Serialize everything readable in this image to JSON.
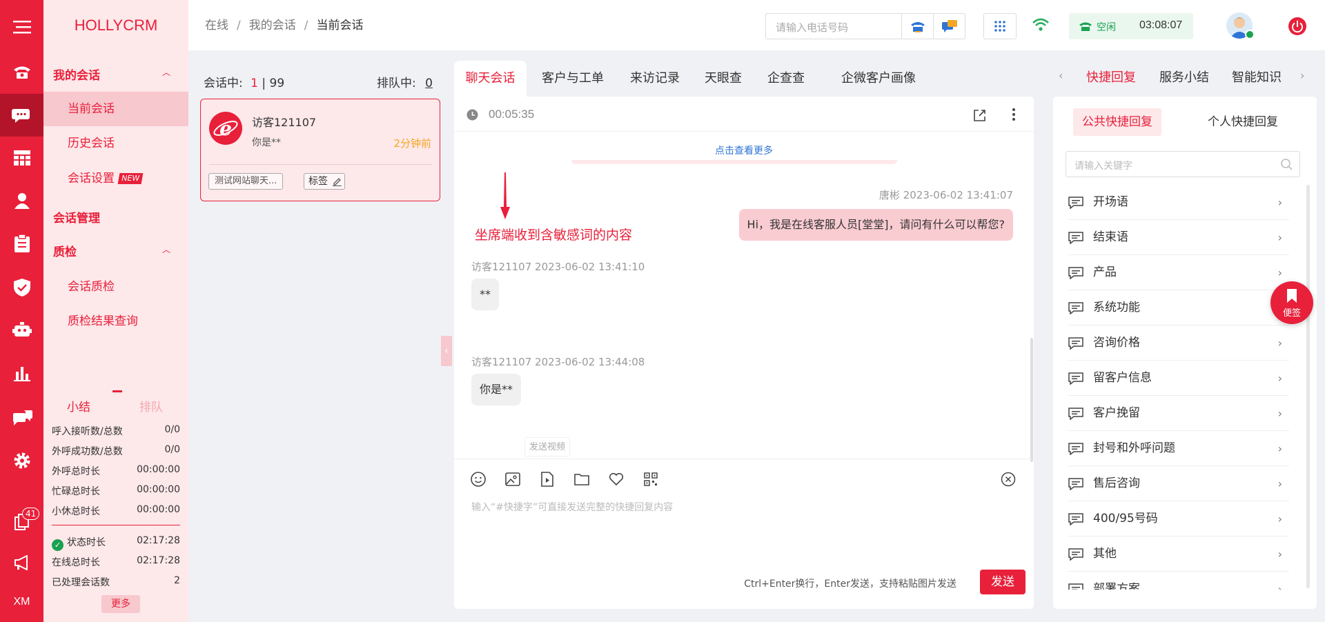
{
  "app": {
    "logo": "HOLLYCRM"
  },
  "rail": {
    "badge_count": "41",
    "bottom_label": "XM"
  },
  "menu": {
    "group_my_sessions": "我的会话",
    "current": "当前会话",
    "history": "历史会话",
    "settings": "会话设置",
    "new_tag": "NEW",
    "session_mgmt": "会话管理",
    "qc": "质检",
    "qc_session": "会话质检",
    "qc_query": "质检结果查询"
  },
  "stats": {
    "tab_summary": "小结",
    "tab_queue": "排队",
    "rows": [
      {
        "label": "呼入接听数/总数",
        "value": "0/0"
      },
      {
        "label": "外呼成功数/总数",
        "value": "0/0"
      },
      {
        "label": "外呼总时长",
        "value": "00:00:00"
      },
      {
        "label": "忙碌总时长",
        "value": "00:00:00"
      },
      {
        "label": "小休总时长",
        "value": "00:00:00"
      }
    ],
    "rows2": [
      {
        "label": "状态时长",
        "value": "02:17:28"
      },
      {
        "label": "在线总时长",
        "value": "02:17:28"
      },
      {
        "label": "已处理会话数",
        "value": "2"
      }
    ],
    "more": "更多"
  },
  "header": {
    "crumbs": [
      "在线",
      "我的会话",
      "当前会话"
    ],
    "phone_placeholder": "请输入电话号码",
    "status": "空闲",
    "timer": "03:08:07"
  },
  "sessions": {
    "label_active": "会话中:",
    "active_count": "1",
    "sep_total": "| 99",
    "label_queue": "排队中:",
    "queue_count": "0",
    "card": {
      "name": "访客121107",
      "preview": "你是**",
      "time": "2分钟前",
      "source": "测试网站聊天...",
      "tag_btn": "标签"
    }
  },
  "chat": {
    "tabs": [
      "聊天会话",
      "客户与工单",
      "来访记录",
      "天眼查",
      "企查查",
      "企微客户画像"
    ],
    "duration": "00:05:35",
    "load_more": "点击查看更多",
    "annotation": "坐席端收到含敏感词的内容",
    "messages": [
      {
        "meta": "唐彬 2023-06-02 13:41:07",
        "text": "Hi，我是在线客服人员[堂堂]，请问有什么可以帮您?"
      },
      {
        "meta": "访客121107 2023-06-02 13:41:10",
        "text": "**"
      },
      {
        "meta": "访客121107 2023-06-02 13:44:08",
        "text": "你是**"
      }
    ],
    "tooltip": "发送视频",
    "input_placeholder": "输入“#快捷字”可直接发送完整的快捷回复内容",
    "hint": "Ctrl+Enter换行，Enter发送，支持粘贴图片发送",
    "send": "发送"
  },
  "right": {
    "tabs": [
      "快捷回复",
      "服务小结",
      "智能知识"
    ],
    "subtabs": [
      "公共快捷回复",
      "个人快捷回复"
    ],
    "search_placeholder": "请输入关键字",
    "items": [
      "开场语",
      "结束语",
      "产品",
      "系统功能",
      "咨询价格",
      "留客户信息",
      "客户挽留",
      "封号和外呼问题",
      "售后咨询",
      "400/95号码",
      "其他",
      "部署方案"
    ],
    "float_label": "便签"
  },
  "colors": {
    "brand": "#e8203a",
    "brand_dark": "#b4142a",
    "status_green": "#1aa251"
  }
}
